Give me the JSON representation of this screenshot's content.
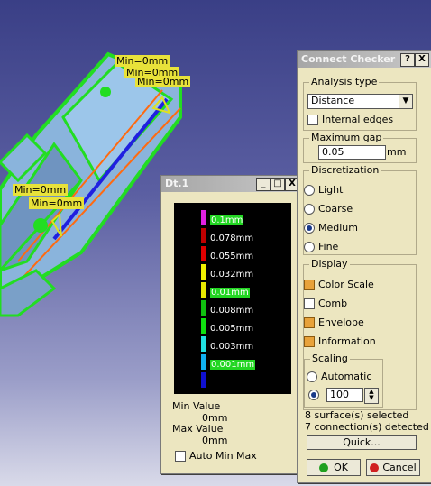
{
  "viewport": {
    "labels": [
      "Min=0mm",
      "Min=0mm",
      "Min=0mm",
      "Min=0mm",
      "Min=0mm"
    ]
  },
  "dt_window": {
    "title": "Dt.1",
    "minimize": "_",
    "maximize": "□",
    "close": "X",
    "scale": [
      {
        "label": "0.1mm",
        "color": "#e020e0",
        "highlighted": true
      },
      {
        "label": "0.078mm",
        "color": "#c00000",
        "highlighted": false
      },
      {
        "label": "0.055mm",
        "color": "#e00000",
        "highlighted": false
      },
      {
        "label": "0.032mm",
        "color": "#f0f000",
        "highlighted": false
      },
      {
        "label": "0.01mm",
        "color": "#e8e800",
        "highlighted": true
      },
      {
        "label": "0.008mm",
        "color": "#10c010",
        "highlighted": false
      },
      {
        "label": "0.005mm",
        "color": "#10e010",
        "highlighted": false
      },
      {
        "label": "0.003mm",
        "color": "#20e0e0",
        "highlighted": false
      },
      {
        "label": "0.001mm",
        "color": "#10b0f0",
        "highlighted": true
      },
      {
        "label": "",
        "color": "#1010d0",
        "highlighted": false
      }
    ],
    "min_value_label": "Min Value",
    "min_value": "0mm",
    "max_value_label": "Max Value",
    "max_value": "0mm",
    "auto_min_max": "Auto Min Max"
  },
  "connect_checker": {
    "title": "Connect Checker",
    "help": "?",
    "close": "X",
    "analysis_type_label": "Analysis type",
    "analysis_type_value": "Distance",
    "internal_edges": "Internal edges",
    "maximum_gap_label": "Maximum gap",
    "maximum_gap_value": "0.05",
    "maximum_gap_unit": "mm",
    "discretization_label": "Discretization",
    "discretization_options": [
      "Light",
      "Coarse",
      "Medium",
      "Fine"
    ],
    "discretization_selected": "Medium",
    "display_label": "Display",
    "display_options": [
      {
        "label": "Color Scale",
        "checked": true
      },
      {
        "label": "Comb",
        "checked": false
      },
      {
        "label": "Envelope",
        "checked": true
      },
      {
        "label": "Information",
        "checked": true
      }
    ],
    "scaling_label": "Scaling",
    "automatic": "Automatic",
    "scaling_value": "100",
    "surfaces_selected": "8 surface(s) selected",
    "connections_detected": "7 connection(s) detected",
    "quick": "Quick...",
    "ok": "OK",
    "cancel": "Cancel"
  }
}
